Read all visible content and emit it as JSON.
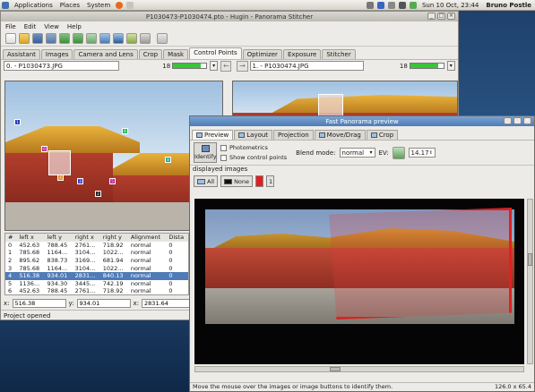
{
  "panel": {
    "menus": [
      "Applications",
      "Places",
      "System"
    ],
    "clock": "Sun 10 Oct, 23:44",
    "user": "Bruno Postle"
  },
  "hugin": {
    "title": "P1030473-P1030474.pto - Hugin - Panorama Stitcher",
    "menu": [
      "File",
      "Edit",
      "View",
      "Help"
    ],
    "tabs": [
      "Assistant",
      "Images",
      "Camera and Lens",
      "Crop",
      "Mask",
      "Control Points",
      "Optimizer",
      "Exposure",
      "Stitcher"
    ],
    "active_tab": "Control Points",
    "left_image": {
      "label": "0. - P1030473.JPG",
      "count": "18",
      "fill": 0.85
    },
    "right_image": {
      "label": "1. - P1030474.JPG",
      "count": "18",
      "fill": 0.85
    },
    "table": {
      "headers": [
        "#",
        "left x",
        "left y",
        "right x",
        "right y",
        "Alignment",
        "Dista"
      ],
      "rows": [
        [
          "0",
          "452.63",
          "788.45",
          "2761...",
          "718.92",
          "normal",
          "0"
        ],
        [
          "1",
          "785.68",
          "1164...",
          "3104...",
          "1022...",
          "normal",
          "0"
        ],
        [
          "2",
          "895.62",
          "838.73",
          "3169...",
          "681.94",
          "normal",
          "0"
        ],
        [
          "3",
          "785.68",
          "1164...",
          "3104...",
          "1022...",
          "normal",
          "0"
        ],
        [
          "4",
          "516.38",
          "934.01",
          "2831...",
          "840.13",
          "normal",
          "0"
        ],
        [
          "5",
          "1136...",
          "934.30",
          "3445...",
          "742.19",
          "normal",
          "0"
        ],
        [
          "6",
          "452.63",
          "788.45",
          "2761...",
          "718.92",
          "normal",
          "0"
        ]
      ],
      "selected_row": 4
    },
    "edit": {
      "x_label": "x:",
      "x_value": "516.38",
      "y_label": "y:",
      "y_value": "934.01",
      "x2_label": "x:",
      "x2_value": "2831.64"
    },
    "status": "Project opened"
  },
  "preview": {
    "title": "Fast Panorama preview",
    "tabs": [
      "Preview",
      "Layout",
      "Projection",
      "Move/Drag",
      "Crop"
    ],
    "active_tab": "Preview",
    "identify_label": "Identify",
    "photometrics_label": "Photometrics",
    "show_cp_label": "Show control points",
    "blend_label": "Blend mode:",
    "blend_value": "normal",
    "ev_label": "EV:",
    "ev_value": "14.17",
    "displayed_label": "displayed images",
    "all_label": "All",
    "none_label": "None",
    "image_button_1": "1",
    "status": "Move the mouse over the images or image buttons to identify them.",
    "fov": "126.0 x 65.4"
  },
  "colors": {
    "selection": "#4f7bb6",
    "progress": "#3ac43a",
    "highlight": "#e02020",
    "preview_title": "#5a86bd"
  }
}
